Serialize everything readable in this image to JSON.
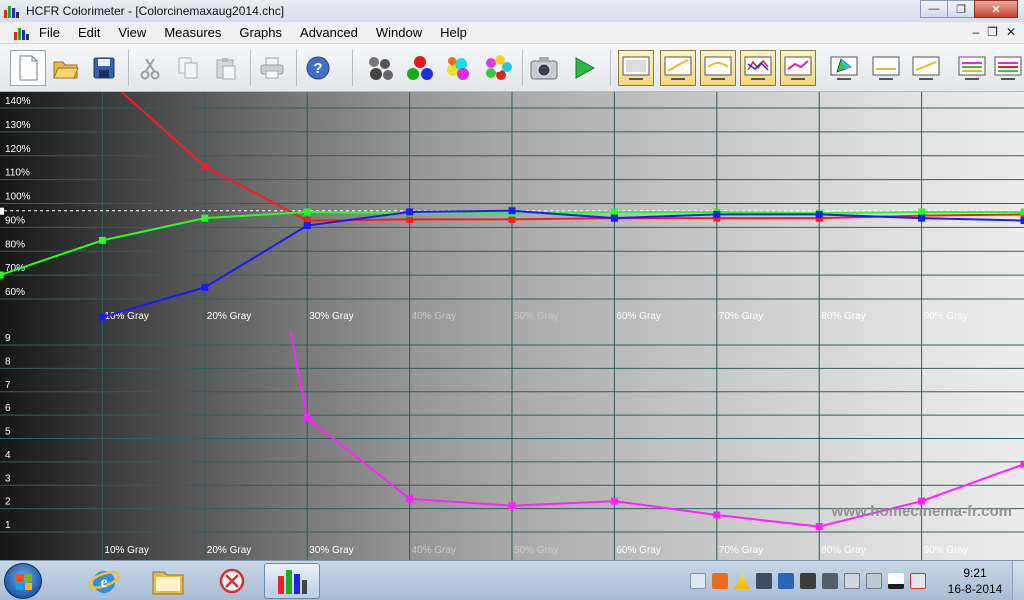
{
  "window": {
    "title": "HCFR Colorimeter - [Colorcinemaxaug2014.chc]",
    "minimize_icon": "minimize-icon",
    "maximize_icon": "maximize-icon",
    "close_icon": "close-icon"
  },
  "menu": {
    "items": [
      "File",
      "Edit",
      "View",
      "Measures",
      "Graphs",
      "Advanced",
      "Window",
      "Help"
    ],
    "mdi_minimize": "–",
    "mdi_restore": "❐",
    "mdi_close": "✕"
  },
  "toolbar": {
    "buttons": [
      "new-document-icon",
      "open-folder-icon",
      "save-icon",
      "cut-icon",
      "copy-icon",
      "paste-icon",
      "print-icon",
      "help-icon",
      "sensor-icon",
      "primaries-icon",
      "secondaries-icon",
      "color-checker-icon",
      "camera-icon",
      "play-icon",
      "graph-view-1-icon",
      "graph-view-2-icon",
      "graph-view-3-icon",
      "graph-view-4-icon",
      "graph-view-5-icon",
      "cie-diagram-icon",
      "graph-view-6-icon",
      "graph-view-7-icon",
      "graph-view-8-icon",
      "graph-view-9-icon",
      "graph-view-10-icon"
    ],
    "pressed": [
      14,
      15,
      16,
      17,
      18
    ]
  },
  "chart_data": [
    {
      "type": "line",
      "categories": [
        "",
        "10% Gray",
        "20% Gray",
        "30% Gray",
        "40% Gray",
        "50% Gray",
        "60% Gray",
        "70% Gray",
        "80% Gray",
        "90% Gray",
        ""
      ],
      "y_ticks": [
        "60%",
        "70%",
        "80%",
        "90%",
        "100%",
        "110%",
        "120%",
        "130%",
        "140%"
      ],
      "ylim": [
        55,
        148
      ],
      "reference_line": 100,
      "series": [
        {
          "color": "#ff1a1a",
          "values": [
            null,
            155,
            118,
            96,
            96.5,
            96.5,
            97,
            97,
            97,
            98,
            98.5
          ]
        },
        {
          "color": "#22ff22",
          "values": [
            74,
            88,
            97,
            99.5,
            99,
            99,
            99.5,
            99.5,
            99,
            99.5,
            99.5
          ]
        },
        {
          "color": "#1a1aff",
          "values": [
            null,
            57,
            69,
            94,
            99.5,
            100,
            97,
            98.5,
            98.5,
            97,
            96
          ]
        }
      ]
    },
    {
      "type": "line",
      "categories": [
        "",
        "10% Gray",
        "20% Gray",
        "30% Gray",
        "40% Gray",
        "50% Gray",
        "60% Gray",
        "70% Gray",
        "80% Gray",
        "90% Gray",
        ""
      ],
      "y_ticks": [
        "1",
        "2",
        "3",
        "4",
        "5",
        "6",
        "7",
        "8",
        "9"
      ],
      "ylim": [
        0,
        9.6
      ],
      "series": [
        {
          "color": "#ff22ff",
          "values": [
            null,
            null,
            null,
            5.8,
            2.3,
            2.0,
            2.2,
            1.6,
            1.1,
            2.2,
            3.8
          ]
        }
      ],
      "series_start_value": 9.5
    }
  ],
  "watermark": "www.homecinema-fr.com",
  "taskbar": {
    "buttons": [
      "internet-explorer-icon",
      "folder-icon",
      "snipping-tool-icon",
      "hcfr-icon"
    ],
    "active": 3,
    "tray_icons": [
      "keyboard-icon",
      "security-icon",
      "warning-icon",
      "monitor-icon",
      "device-icon",
      "power-icon",
      "usb-icon",
      "volume-icon",
      "volume-alt-icon",
      "network-icon",
      "network-x-icon"
    ],
    "time": "9:21",
    "date": "16-8-2014"
  }
}
